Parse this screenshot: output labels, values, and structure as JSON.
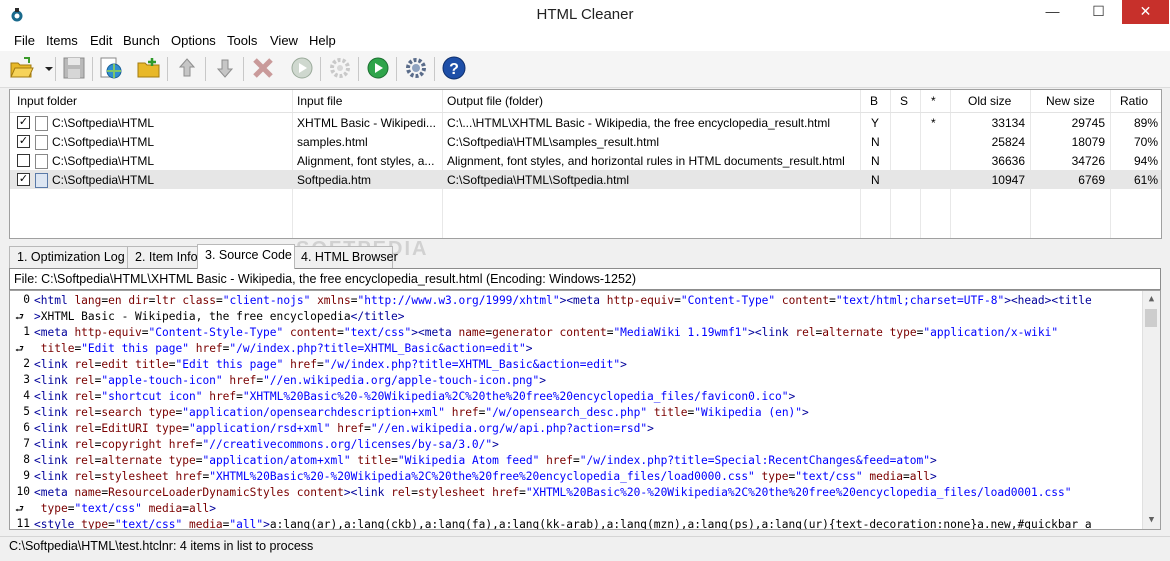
{
  "window": {
    "title": "HTML Cleaner",
    "minimize": "—",
    "maximize": "☐",
    "close": "✕"
  },
  "menu": [
    "File",
    "Items",
    "Edit",
    "Bunch",
    "Options",
    "Tools",
    "View",
    "Help"
  ],
  "toolbar": {
    "icons": [
      "open-folder-icon",
      "dropdown-arrow-icon",
      "save-icon",
      "add-web-icon",
      "add-folder-icon",
      "move-up-icon",
      "move-down-icon",
      "delete-icon",
      "run-icon",
      "settings-disabled-icon",
      "run-all-icon",
      "options-gear-icon",
      "help-icon"
    ]
  },
  "grid": {
    "columns": [
      "Input folder",
      "Input file",
      "Output file (folder)",
      "B",
      "S",
      "*",
      "Old size",
      "New size",
      "Ratio"
    ],
    "rows": [
      {
        "checked": true,
        "folder": "C:\\Softpedia\\HTML",
        "file": "XHTML Basic - Wikipedi...",
        "output": "C:\\...\\HTML\\XHTML Basic - Wikipedia, the free encyclopedia_result.html",
        "b": "Y",
        "s": "",
        "star": "*",
        "old": "33134",
        "new": "29745",
        "ratio": "89%"
      },
      {
        "checked": true,
        "folder": "C:\\Softpedia\\HTML",
        "file": "samples.html",
        "output": "C:\\Softpedia\\HTML\\samples_result.html",
        "b": "N",
        "s": "",
        "star": "",
        "old": "25824",
        "new": "18079",
        "ratio": "70%"
      },
      {
        "checked": false,
        "folder": "C:\\Softpedia\\HTML",
        "file": "Alignment, font styles, a...",
        "output": "Alignment, font styles, and horizontal rules in HTML documents_result.html",
        "b": "N",
        "s": "",
        "star": "",
        "old": "36636",
        "new": "34726",
        "ratio": "94%"
      },
      {
        "checked": true,
        "folder": "C:\\Softpedia\\HTML",
        "file": "Softpedia.htm",
        "output": "C:\\Softpedia\\HTML\\Softpedia.html",
        "b": "N",
        "s": "",
        "star": "",
        "old": "10947",
        "new": "6769",
        "ratio": "61%"
      }
    ]
  },
  "tabs": [
    "1. Optimization Log",
    "2. Item Info",
    "3. Source Code",
    "4. HTML Browser"
  ],
  "file_info": "File: C:\\Softpedia\\HTML\\XHTML Basic - Wikipedia, the free encyclopedia_result.html (Encoding: Windows-1252)",
  "code_lines": [
    {
      "n": "0",
      "html": "<span class='t'>&lt;html</span> <span class='a'>lang</span>=<span class='a'>en</span> <span class='a'>dir</span>=<span class='a'>ltr</span> <span class='a'>class</span>=<span class='v'>\"client-nojs\"</span> <span class='a'>xmlns</span>=<span class='v'>\"http://www.w3.org/1999/xhtml\"</span><span class='t'>&gt;&lt;meta</span> <span class='a'>http-equiv</span>=<span class='v'>\"Content-Type\"</span> <span class='a'>content</span>=<span class='v'>\"text/html;charset=UTF-8\"</span><span class='t'>&gt;&lt;head&gt;&lt;title</span>"
    },
    {
      "n": "",
      "html": "<span class='t'>&gt;</span>XHTML Basic - Wikipedia, the free encyclopedia<span class='t'>&lt;/title&gt;</span>"
    },
    {
      "n": "1",
      "html": "<span class='t'>&lt;meta</span> <span class='a'>http-equiv</span>=<span class='v'>\"Content-Style-Type\"</span> <span class='a'>content</span>=<span class='v'>\"text/css\"</span><span class='t'>&gt;&lt;meta</span> <span class='a'>name</span>=<span class='a'>generator</span> <span class='a'>content</span>=<span class='v'>\"MediaWiki 1.19wmf1\"</span><span class='t'>&gt;&lt;link</span> <span class='a'>rel</span>=<span class='a'>alternate</span> <span class='a'>type</span>=<span class='v'>\"application/x-wiki\"</span>"
    },
    {
      "n": "",
      "html": " <span class='a'>title</span>=<span class='v'>\"Edit this page\"</span> <span class='a'>href</span>=<span class='v'>\"/w/index.php?title=XHTML_Basic&amp;action=edit\"</span><span class='t'>&gt;</span>"
    },
    {
      "n": "2",
      "html": "<span class='t'>&lt;link</span> <span class='a'>rel</span>=<span class='a'>edit</span> <span class='a'>title</span>=<span class='v'>\"Edit this page\"</span> <span class='a'>href</span>=<span class='v'>\"/w/index.php?title=XHTML_Basic&amp;action=edit\"</span><span class='t'>&gt;</span>"
    },
    {
      "n": "3",
      "html": "<span class='t'>&lt;link</span> <span class='a'>rel</span>=<span class='v'>\"apple-touch-icon\"</span> <span class='a'>href</span>=<span class='v'>\"//en.wikipedia.org/apple-touch-icon.png\"</span><span class='t'>&gt;</span>"
    },
    {
      "n": "4",
      "html": "<span class='t'>&lt;link</span> <span class='a'>rel</span>=<span class='v'>\"shortcut icon\"</span> <span class='a'>href</span>=<span class='v'>\"XHTML%20Basic%20-%20Wikipedia%2C%20the%20free%20encyclopedia_files/favicon0.ico\"</span><span class='t'>&gt;</span>"
    },
    {
      "n": "5",
      "html": "<span class='t'>&lt;link</span> <span class='a'>rel</span>=<span class='a'>search</span> <span class='a'>type</span>=<span class='v'>\"application/opensearchdescription+xml\"</span> <span class='a'>href</span>=<span class='v'>\"/w/opensearch_desc.php\"</span> <span class='a'>title</span>=<span class='v'>\"Wikipedia (en)\"</span><span class='t'>&gt;</span>"
    },
    {
      "n": "6",
      "html": "<span class='t'>&lt;link</span> <span class='a'>rel</span>=<span class='a'>EditURI</span> <span class='a'>type</span>=<span class='v'>\"application/rsd+xml\"</span> <span class='a'>href</span>=<span class='v'>\"//en.wikipedia.org/w/api.php?action=rsd\"</span><span class='t'>&gt;</span>"
    },
    {
      "n": "7",
      "html": "<span class='t'>&lt;link</span> <span class='a'>rel</span>=<span class='a'>copyright</span> <span class='a'>href</span>=<span class='v'>\"//creativecommons.org/licenses/by-sa/3.0/\"</span><span class='t'>&gt;</span>"
    },
    {
      "n": "8",
      "html": "<span class='t'>&lt;link</span> <span class='a'>rel</span>=<span class='a'>alternate</span> <span class='a'>type</span>=<span class='v'>\"application/atom+xml\"</span> <span class='a'>title</span>=<span class='v'>\"Wikipedia Atom feed\"</span> <span class='a'>href</span>=<span class='v'>\"/w/index.php?title=Special:RecentChanges&amp;feed=atom\"</span><span class='t'>&gt;</span>"
    },
    {
      "n": "9",
      "html": "<span class='t'>&lt;link</span> <span class='a'>rel</span>=<span class='a'>stylesheet</span> <span class='a'>href</span>=<span class='v'>\"XHTML%20Basic%20-%20Wikipedia%2C%20the%20free%20encyclopedia_files/load0000.css\"</span> <span class='a'>type</span>=<span class='v'>\"text/css\"</span> <span class='a'>media</span>=<span class='a'>all</span><span class='t'>&gt;</span>"
    },
    {
      "n": "10",
      "html": "<span class='t'>&lt;meta</span> <span class='a'>name</span>=<span class='a'>ResourceLoaderDynamicStyles</span> <span class='a'>content</span><span class='t'>&gt;&lt;link</span> <span class='a'>rel</span>=<span class='a'>stylesheet</span> <span class='a'>href</span>=<span class='v'>\"XHTML%20Basic%20-%20Wikipedia%2C%20the%20free%20encyclopedia_files/load0001.css\"</span>"
    },
    {
      "n": "",
      "html": " <span class='a'>type</span>=<span class='v'>\"text/css\"</span> <span class='a'>media</span>=<span class='a'>all</span><span class='t'>&gt;</span>"
    },
    {
      "n": "11",
      "html": "<span class='t'>&lt;style</span> <span class='a'>type</span>=<span class='v'>\"text/css\"</span> <span class='a'>media</span>=<span class='v'>\"all\"</span><span class='t'>&gt;</span>a:lang(ar),a:lang(ckb),a:lang(fa),a:lang(kk-arab),a:lang(mzn),a:lang(ps),a:lang(ur){text-decoration:none}a.new,#quickbar a"
    }
  ],
  "status": "C:\\Softpedia\\HTML\\test.htclnr: 4 items in list to process",
  "watermark": "SOFTPEDIA"
}
